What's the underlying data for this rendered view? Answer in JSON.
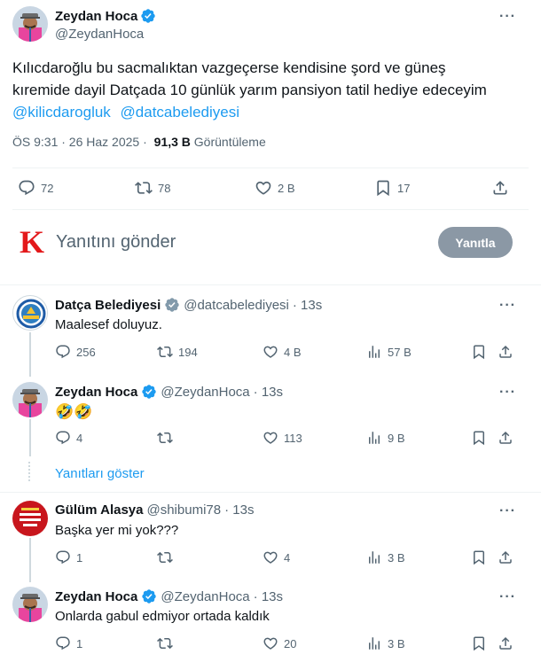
{
  "main": {
    "author_name": "Zeydan Hoca",
    "author_handle": "@ZeydanHoca",
    "text_line1": "Kılıcdaroğlu bu sacmalıktan  vazgeçerse  kendisine şord ve güneş",
    "text_line2": "kıremide dayil Datçada  10 günlük yarım pansiyon tatil hediye edeceyim",
    "mention1": "@kilicdarogluk",
    "mention2": "@datcabelediyesi",
    "time": "ÖS 9:31 · 26 Haz 2025 ·",
    "views_count": "91,3 B",
    "views_label": "Görüntüleme",
    "replies": "72",
    "retweets": "78",
    "likes": "2 B",
    "bookmarks": "17"
  },
  "compose": {
    "logo_letter": "K",
    "placeholder": "Yanıtını gönder",
    "button": "Yanıtla"
  },
  "replies": [
    {
      "name": "Datça Belediyesi",
      "handle": "@datcabelediyesi",
      "time": "· 13s",
      "verified_color": "#829aab",
      "text": "Maalesef doluyuz.",
      "replies": "256",
      "retweets": "194",
      "likes": "4 B",
      "views": "57 B"
    },
    {
      "name": "Zeydan Hoca",
      "handle": "@ZeydanHoca",
      "time": "· 13s",
      "verified_color": "#1d9bf0",
      "text": "🤣🤣",
      "replies": "4",
      "retweets": "",
      "likes": "113",
      "views": "9 B"
    },
    {
      "name": "Gülüm Alasya",
      "handle": "@shibumi78",
      "time": "· 13s",
      "text": "Başka yer mi yok???",
      "replies": "1",
      "retweets": "",
      "likes": "4",
      "views": "3 B"
    },
    {
      "name": "Zeydan Hoca",
      "handle": "@ZeydanHoca",
      "time": "· 13s",
      "verified_color": "#1d9bf0",
      "text": "Onlarda gabul edmiyor ortada kaldık",
      "replies": "1",
      "retweets": "",
      "likes": "20",
      "views": "3 B"
    }
  ],
  "show_replies": "Yanıtları göster",
  "colors": {
    "accent": "#1d9bf0",
    "muted": "#536471",
    "border": "#eff3f4",
    "button_bg": "#8b98a5"
  }
}
